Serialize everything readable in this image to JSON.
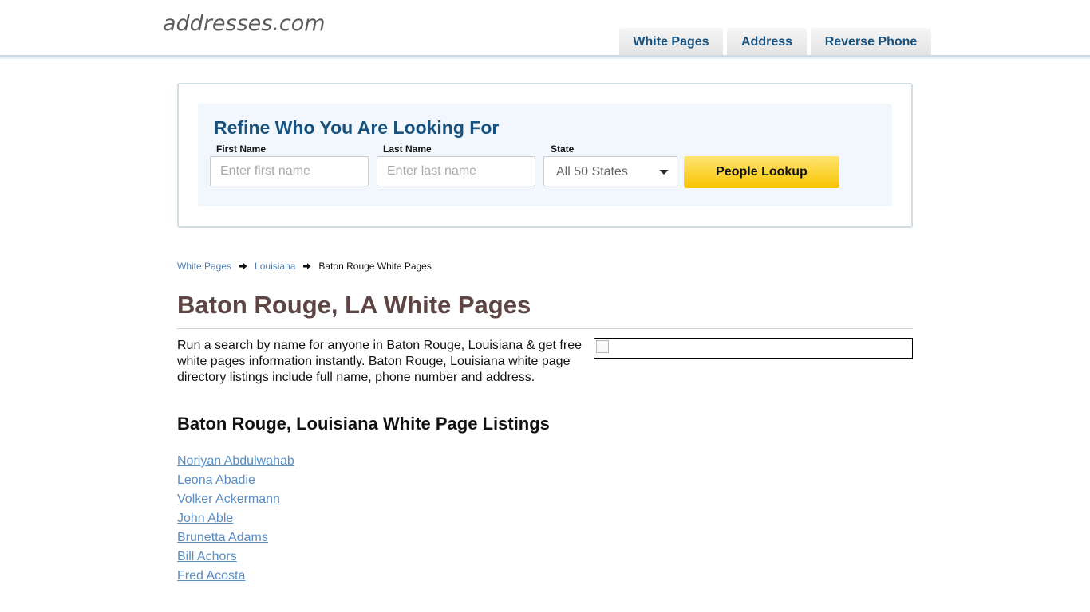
{
  "header": {
    "logo": "addresses.com",
    "nav": [
      {
        "label": "White Pages"
      },
      {
        "label": "Address"
      },
      {
        "label": "Reverse Phone"
      }
    ]
  },
  "search": {
    "title": "Refine Who You Are Looking For",
    "first_name_label": "First Name",
    "first_name_placeholder": "Enter first name",
    "first_name_value": "",
    "last_name_label": "Last Name",
    "last_name_placeholder": "Enter last name",
    "last_name_value": "",
    "state_label": "State",
    "state_selected": "All 50 States",
    "button_label": "People Lookup"
  },
  "breadcrumb": {
    "items": [
      "White Pages",
      "Louisiana"
    ],
    "current": "Baton Rouge White Pages"
  },
  "main": {
    "title": "Baton Rouge, LA White Pages",
    "intro": "Run a search by name for anyone in Baton Rouge, Louisiana & get free white pages information instantly. Baton Rouge, Louisiana white page directory listings include full name, phone number and address.",
    "listings_title": "Baton Rouge, Louisiana White Page Listings",
    "listings": [
      "Noriyan Abdulwahab",
      "Leona Abadie",
      "Volker Ackermann",
      "John Able",
      "Brunetta Adams",
      "Bill Achors",
      "Fred Acosta"
    ]
  },
  "colors": {
    "brand_blue": "#17517e",
    "title_brown": "#5e4544",
    "link_blue": "#5b8ec4",
    "button_yellow": "#f9c400",
    "panel_bg": "#f1f7fc"
  },
  "icons": {
    "breadcrumb_separator": "arrow-right-icon",
    "state_dropdown": "chevron-down-icon",
    "ad_image": "broken-image-icon"
  }
}
